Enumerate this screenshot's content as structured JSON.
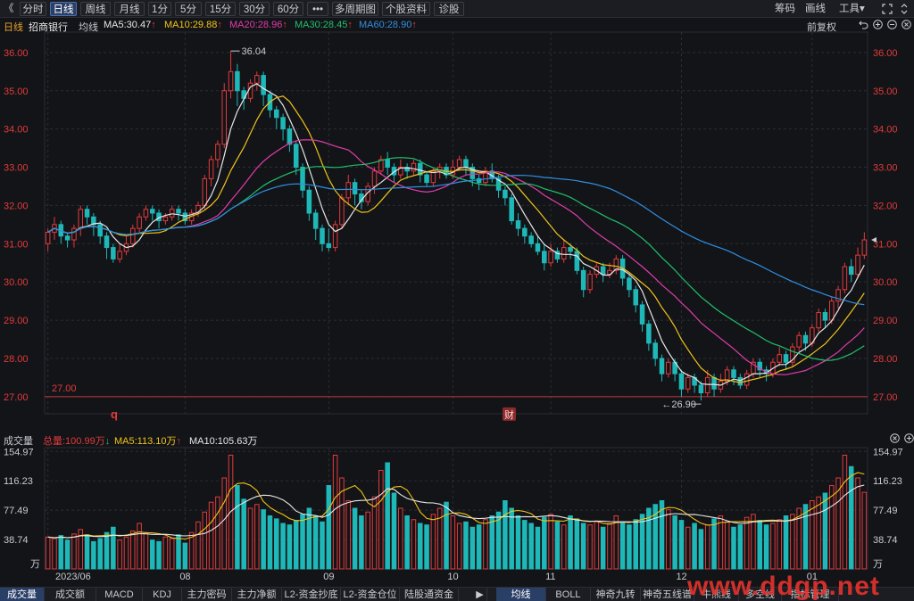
{
  "toolbar": {
    "back_icon": "double-left-chevron",
    "periods": [
      "分时",
      "日线",
      "周线",
      "月线",
      "1分",
      "5分",
      "15分",
      "30分",
      "60分",
      "•••",
      "多周期图",
      "个股资料",
      "诊股"
    ],
    "active_period": "日线",
    "right": [
      "筹码",
      "画线",
      "工具▾"
    ],
    "expand_icon": "expand-icon",
    "scroll_icon": "scroll-updown-icon"
  },
  "info": {
    "period": "日线",
    "stock": "招商银行",
    "ma_label": "均线",
    "ma5": "MA5:30.47",
    "ma10": "MA10:29.88",
    "ma20": "MA20:28.96",
    "ma30": "MA30:28.45",
    "ma60": "MA60:28.90",
    "adjust": "前复权",
    "up_arrow": "↑"
  },
  "colors": {
    "up": "#e23b3b",
    "down": "#1fb8b8",
    "ma5": "#e8e8e8",
    "ma10": "#f0c419",
    "ma20": "#e03caa",
    "ma30": "#21c06b",
    "ma60": "#2f8fe0",
    "grid": "#2a2d33",
    "axis_text": "#e23b3b",
    "bg": "#131418"
  },
  "annotations": {
    "high_label": "36.04",
    "low_label": "26.90",
    "ref_line": "27.00",
    "q_marker": "q",
    "cai_marker": "财"
  },
  "volume": {
    "title": "成交量",
    "total": "总量:100.99万",
    "total_arrow": "↓",
    "ma5": "MA5:113.10万",
    "ma5_arrow": "↑",
    "ma10": "MA10:105.63万",
    "unit": "万"
  },
  "tabs_left": [
    "成交量",
    "成交额",
    "MACD",
    "KDJ",
    "主力密码",
    "主力净额",
    "L2-资金抄底",
    "L2-资金仓位",
    "陆股通资金"
  ],
  "tabs_right": [
    "均线",
    "BOLL",
    "神奇九转",
    "神奇五线谱",
    "牛熊线",
    "多空线",
    "指标管理"
  ],
  "tab_more": "▶",
  "watermark": "www.ddgp.net",
  "chart_data": {
    "type": "candlestick",
    "price_axis_ticks": [
      "36.00",
      "35.00",
      "34.00",
      "33.00",
      "32.00",
      "31.00",
      "30.00",
      "29.00",
      "28.00",
      "27.00"
    ],
    "price_range": [
      26.6,
      36.3
    ],
    "volume_axis_ticks": [
      "154.97",
      "116.23",
      "77.49",
      "38.74"
    ],
    "volume_range": [
      0,
      160
    ],
    "x_labels": [
      {
        "i": 0,
        "label": "2023/06"
      },
      {
        "i": 21,
        "label": "08"
      },
      {
        "i": 43,
        "label": "09"
      },
      {
        "i": 62,
        "label": "10"
      },
      {
        "i": 77,
        "label": "11"
      },
      {
        "i": 97,
        "label": "12"
      },
      {
        "i": 117,
        "label": "01"
      }
    ],
    "ohlc": [
      [
        31.0,
        31.3,
        30.8,
        31.4
      ],
      [
        31.3,
        31.5,
        31.1,
        31.7
      ],
      [
        31.5,
        31.2,
        31.0,
        31.6
      ],
      [
        31.2,
        31.1,
        30.9,
        31.3
      ],
      [
        31.1,
        31.4,
        30.9,
        31.5
      ],
      [
        31.4,
        31.9,
        31.2,
        32.0
      ],
      [
        31.9,
        31.7,
        31.5,
        32.0
      ],
      [
        31.7,
        31.5,
        31.2,
        31.8
      ],
      [
        31.5,
        31.2,
        31.0,
        31.6
      ],
      [
        31.2,
        30.9,
        30.6,
        31.3
      ],
      [
        30.9,
        30.6,
        30.5,
        31.0
      ],
      [
        30.6,
        30.8,
        30.5,
        31.0
      ],
      [
        30.8,
        31.0,
        30.7,
        31.2
      ],
      [
        31.0,
        31.4,
        30.9,
        31.5
      ],
      [
        31.4,
        31.7,
        31.3,
        31.8
      ],
      [
        31.7,
        31.9,
        31.6,
        32.0
      ],
      [
        31.9,
        31.8,
        31.6,
        32.0
      ],
      [
        31.8,
        31.6,
        31.4,
        31.9
      ],
      [
        31.6,
        31.7,
        31.5,
        31.8
      ],
      [
        31.7,
        31.9,
        31.6,
        32.0
      ],
      [
        31.9,
        31.8,
        31.6,
        32.0
      ],
      [
        31.8,
        31.6,
        31.5,
        31.9
      ],
      [
        31.6,
        31.8,
        31.5,
        31.9
      ],
      [
        31.8,
        32.0,
        31.7,
        32.1
      ],
      [
        32.0,
        32.7,
        31.9,
        32.8
      ],
      [
        32.7,
        33.2,
        32.5,
        33.3
      ],
      [
        33.2,
        33.6,
        33.0,
        33.7
      ],
      [
        33.6,
        35.0,
        33.5,
        35.2
      ],
      [
        35.0,
        35.5,
        34.8,
        36.04
      ],
      [
        35.5,
        35.0,
        34.6,
        35.7
      ],
      [
        35.0,
        34.8,
        34.5,
        35.1
      ],
      [
        34.8,
        35.2,
        34.7,
        35.3
      ],
      [
        35.2,
        35.4,
        35.0,
        35.5
      ],
      [
        35.4,
        34.9,
        34.6,
        35.5
      ],
      [
        34.9,
        34.5,
        34.3,
        35.0
      ],
      [
        34.5,
        34.3,
        34.0,
        34.6
      ],
      [
        34.3,
        34.0,
        33.7,
        34.4
      ],
      [
        34.0,
        33.6,
        33.4,
        34.1
      ],
      [
        33.6,
        33.0,
        32.8,
        33.7
      ],
      [
        33.0,
        32.4,
        32.2,
        33.1
      ],
      [
        32.4,
        31.8,
        31.6,
        32.5
      ],
      [
        31.8,
        31.4,
        31.1,
        31.9
      ],
      [
        31.4,
        31.0,
        30.8,
        31.5
      ],
      [
        31.0,
        30.9,
        30.8,
        31.4
      ],
      [
        30.9,
        31.5,
        30.8,
        31.6
      ],
      [
        31.5,
        32.2,
        31.4,
        32.3
      ],
      [
        32.2,
        32.6,
        32.0,
        32.8
      ],
      [
        32.6,
        32.3,
        32.0,
        32.7
      ],
      [
        32.3,
        32.1,
        31.9,
        32.4
      ],
      [
        32.1,
        32.5,
        32.0,
        32.6
      ],
      [
        32.5,
        32.9,
        32.3,
        33.0
      ],
      [
        32.9,
        33.2,
        32.8,
        33.3
      ],
      [
        33.2,
        33.0,
        32.8,
        33.4
      ],
      [
        33.0,
        32.8,
        32.6,
        33.1
      ],
      [
        32.8,
        33.0,
        32.7,
        33.2
      ],
      [
        33.0,
        32.9,
        32.7,
        33.1
      ],
      [
        32.9,
        33.1,
        32.8,
        33.2
      ],
      [
        33.1,
        32.8,
        32.6,
        33.2
      ],
      [
        32.8,
        32.6,
        32.5,
        32.9
      ],
      [
        32.6,
        32.9,
        32.5,
        33.0
      ],
      [
        32.9,
        33.0,
        32.7,
        33.1
      ],
      [
        33.0,
        32.8,
        32.7,
        33.1
      ],
      [
        32.8,
        33.0,
        32.7,
        33.2
      ],
      [
        33.0,
        33.2,
        32.9,
        33.3
      ],
      [
        33.2,
        33.0,
        32.8,
        33.3
      ],
      [
        33.0,
        32.7,
        32.5,
        33.1
      ],
      [
        32.7,
        32.6,
        32.4,
        32.8
      ],
      [
        32.6,
        32.9,
        32.5,
        33.0
      ],
      [
        32.9,
        32.7,
        32.6,
        33.1
      ],
      [
        32.7,
        32.4,
        32.2,
        32.8
      ],
      [
        32.4,
        32.2,
        32.0,
        32.5
      ],
      [
        32.2,
        31.6,
        31.5,
        32.3
      ],
      [
        31.6,
        31.4,
        31.2,
        31.8
      ],
      [
        31.4,
        31.2,
        31.0,
        31.5
      ],
      [
        31.2,
        31.0,
        30.9,
        31.3
      ],
      [
        31.0,
        30.8,
        30.7,
        31.2
      ],
      [
        30.8,
        30.5,
        30.3,
        31.0
      ],
      [
        30.5,
        30.8,
        30.4,
        31.0
      ],
      [
        30.8,
        30.6,
        30.5,
        30.9
      ],
      [
        30.6,
        30.9,
        30.5,
        31.1
      ],
      [
        30.9,
        30.8,
        30.6,
        31.0
      ],
      [
        30.8,
        30.3,
        30.2,
        30.9
      ],
      [
        30.3,
        29.8,
        29.6,
        30.4
      ],
      [
        29.8,
        30.2,
        29.7,
        30.3
      ],
      [
        30.2,
        30.4,
        30.1,
        30.5
      ],
      [
        30.4,
        30.2,
        30.0,
        30.5
      ],
      [
        30.2,
        30.3,
        30.1,
        30.5
      ],
      [
        30.3,
        30.6,
        30.2,
        30.7
      ],
      [
        30.6,
        30.1,
        29.9,
        30.7
      ],
      [
        30.1,
        29.8,
        29.6,
        30.2
      ],
      [
        29.8,
        29.4,
        29.2,
        29.9
      ],
      [
        29.4,
        28.9,
        28.7,
        29.5
      ],
      [
        28.9,
        28.4,
        28.2,
        29.0
      ],
      [
        28.4,
        28.0,
        27.8,
        28.5
      ],
      [
        28.0,
        27.6,
        27.4,
        28.1
      ],
      [
        27.6,
        27.9,
        27.5,
        28.0
      ],
      [
        27.9,
        27.6,
        27.4,
        28.0
      ],
      [
        27.6,
        27.2,
        27.0,
        27.7
      ],
      [
        27.2,
        27.5,
        27.1,
        27.6
      ],
      [
        27.5,
        27.3,
        27.1,
        27.6
      ],
      [
        27.3,
        27.1,
        26.9,
        27.4
      ],
      [
        27.1,
        27.5,
        27.0,
        27.7
      ],
      [
        27.5,
        27.2,
        27.0,
        27.6
      ],
      [
        27.2,
        27.4,
        27.1,
        27.6
      ],
      [
        27.4,
        27.7,
        27.3,
        27.8
      ],
      [
        27.7,
        27.5,
        27.3,
        27.8
      ],
      [
        27.5,
        27.3,
        27.2,
        27.6
      ],
      [
        27.3,
        27.6,
        27.2,
        27.7
      ],
      [
        27.6,
        27.9,
        27.5,
        28.0
      ],
      [
        27.9,
        27.7,
        27.5,
        28.0
      ],
      [
        27.7,
        27.6,
        27.4,
        27.8
      ],
      [
        27.6,
        27.9,
        27.5,
        28.0
      ],
      [
        27.9,
        28.1,
        27.8,
        28.3
      ],
      [
        28.1,
        27.9,
        27.7,
        28.2
      ],
      [
        27.9,
        28.3,
        27.8,
        28.4
      ],
      [
        28.3,
        28.6,
        28.2,
        28.7
      ],
      [
        28.6,
        28.4,
        28.2,
        28.7
      ],
      [
        28.4,
        28.8,
        28.3,
        28.9
      ],
      [
        28.8,
        29.2,
        28.7,
        29.3
      ],
      [
        29.2,
        29.0,
        28.8,
        29.3
      ],
      [
        29.0,
        29.5,
        28.9,
        29.6
      ],
      [
        29.5,
        29.8,
        29.3,
        29.9
      ],
      [
        29.8,
        30.4,
        29.7,
        30.5
      ],
      [
        30.4,
        30.2,
        30.0,
        30.6
      ],
      [
        30.2,
        30.7,
        30.1,
        30.9
      ],
      [
        30.7,
        31.1,
        30.6,
        31.3
      ]
    ],
    "volume": [
      42,
      40,
      44,
      38,
      46,
      52,
      45,
      36,
      40,
      48,
      55,
      38,
      42,
      50,
      60,
      48,
      38,
      36,
      42,
      40,
      45,
      34,
      48,
      62,
      75,
      88,
      95,
      120,
      150,
      110,
      92,
      80,
      85,
      78,
      70,
      66,
      60,
      58,
      64,
      72,
      80,
      70,
      62,
      110,
      150,
      120,
      90,
      80,
      70,
      75,
      95,
      130,
      140,
      100,
      80,
      70,
      65,
      60,
      58,
      72,
      80,
      88,
      70,
      60,
      62,
      55,
      58,
      65,
      70,
      75,
      90,
      80,
      70,
      64,
      60,
      55,
      68,
      72,
      62,
      58,
      70,
      66,
      60,
      58,
      62,
      55,
      60,
      70,
      62,
      58,
      65,
      72,
      80,
      85,
      90,
      78,
      70,
      64,
      55,
      60,
      52,
      58,
      66,
      70,
      62,
      55,
      58,
      68,
      72,
      64,
      58,
      60,
      65,
      70,
      72,
      80,
      85,
      90,
      95,
      100,
      110,
      120,
      150,
      135,
      120,
      101
    ],
    "vol_colors_up": "match candle direction",
    "series": [
      {
        "name": "MA5",
        "last": 30.47
      },
      {
        "name": "MA10",
        "last": 29.88
      },
      {
        "name": "MA20",
        "last": 28.96
      },
      {
        "name": "MA30",
        "last": 28.45
      },
      {
        "name": "MA60",
        "last": 28.9
      }
    ],
    "volume_series": [
      {
        "name": "MA5",
        "last": 113.1
      },
      {
        "name": "MA10",
        "last": 105.63
      }
    ]
  }
}
